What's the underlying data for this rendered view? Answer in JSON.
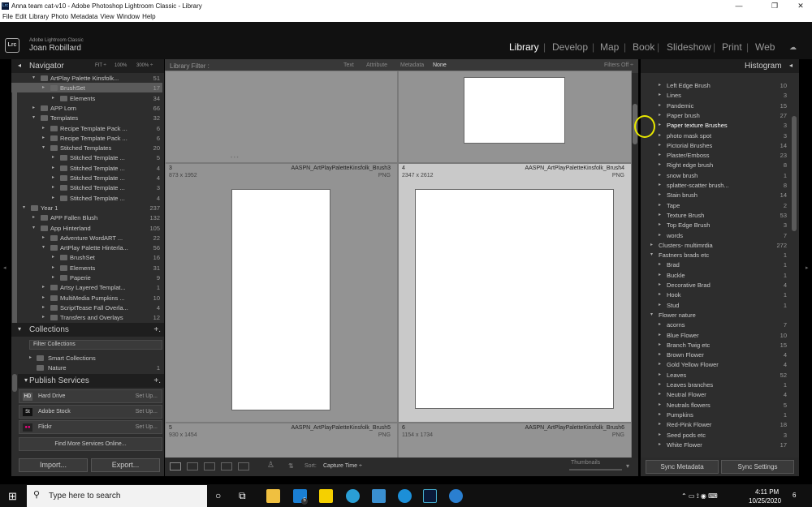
{
  "window": {
    "title": "Anna team cat-v10 - Adobe Photoshop Lightroom Classic - Library",
    "app_icon": "Lrc",
    "minimize": "—",
    "restore": "❐",
    "close": "✕"
  },
  "menu": [
    "File",
    "Edit",
    "Library",
    "Photo",
    "Metadata",
    "View",
    "Window",
    "Help"
  ],
  "identity": {
    "logo": "Lrc",
    "product": "Adobe Lightroom Classic",
    "user": "Joan Robillard"
  },
  "modules": [
    "Library",
    "Develop",
    "Map",
    "Book",
    "Slideshow",
    "Print",
    "Web"
  ],
  "active_module": "Library",
  "navigator": {
    "title": "Navigator",
    "fit": "FIT ÷",
    "z100": "100%",
    "z300": "300% ÷"
  },
  "folders": [
    {
      "label": "ArtPlay Palette Kinsfolk...",
      "count": "51"
    },
    {
      "label": "BrushSet",
      "count": "17"
    },
    {
      "label": "Elements",
      "count": "34"
    },
    {
      "label": "APP Lorn",
      "count": "66"
    },
    {
      "label": "Templates",
      "count": "32"
    },
    {
      "label": "Recipe Template Pack ...",
      "count": "6"
    },
    {
      "label": "Recipe Template Pack ...",
      "count": "6"
    },
    {
      "label": "Stitched Templates",
      "count": "20"
    },
    {
      "label": "Stitched Template ...",
      "count": "5"
    },
    {
      "label": "Stitched Template ...",
      "count": "4"
    },
    {
      "label": "Stitched Template ...",
      "count": "4"
    },
    {
      "label": "Stitched Template ...",
      "count": "3"
    },
    {
      "label": "Stitched Template ...",
      "count": "4"
    },
    {
      "label": "Year 1",
      "count": "237"
    },
    {
      "label": "APP Fallen Blush",
      "count": "132"
    },
    {
      "label": "App Hinterland",
      "count": "105"
    },
    {
      "label": "Adventure WordART ...",
      "count": "22"
    },
    {
      "label": "ArtPlay Palette Hinterla...",
      "count": "56"
    },
    {
      "label": "BrushSet",
      "count": "16"
    },
    {
      "label": "Elements",
      "count": "31"
    },
    {
      "label": "Paperie",
      "count": "9"
    },
    {
      "label": "Artsy Layered Templat...",
      "count": "1"
    },
    {
      "label": "MultiMedia Pumpkins ...",
      "count": "10"
    },
    {
      "label": "ScriptTease Fall Overla...",
      "count": "4"
    },
    {
      "label": "Transfers and Overlays",
      "count": "12"
    }
  ],
  "collections": {
    "title": "Collections",
    "plus": "+.",
    "filter": "Filter Collections",
    "items": [
      {
        "label": "Smart Collections",
        "count": ""
      },
      {
        "label": "Nature",
        "count": "1"
      }
    ]
  },
  "publish": {
    "title": "Publish Services",
    "plus": "+.",
    "services": [
      {
        "label": "Hard Drive",
        "icon": "HD",
        "action": "Set Up..."
      },
      {
        "label": "Adobe Stock",
        "icon": "St",
        "action": "Set Up..."
      },
      {
        "label": "Flickr",
        "icon": "●●",
        "action": "Set Up..."
      }
    ],
    "find_more": "Find More Services Online..."
  },
  "left_buttons": {
    "import": "Import...",
    "export": "Export..."
  },
  "filter_bar": {
    "label": "Library Filter :",
    "tabs": [
      "Text",
      "Attribute",
      "Metadata",
      "None"
    ],
    "filters_off": "Filters Off ÷"
  },
  "grid_cells": [
    {
      "index": "3",
      "dims": "873 x 1952",
      "name": "AASPN_ArtPlayPaletteKinsfolk_Brush3",
      "ext": "PNG"
    },
    {
      "index": "4",
      "dims": "2347 x 2612",
      "name": "AASPN_ArtPlayPaletteKinsfolk_Brush4",
      "ext": "PNG"
    },
    {
      "index": "5",
      "dims": "930 x 1454",
      "name": "AASPN_ArtPlayPaletteKinsfolk_Brush5",
      "ext": "PNG"
    },
    {
      "index": "6",
      "dims": "1154 x 1734",
      "name": "AASPN_ArtPlayPaletteKinsfolk_Brush6",
      "ext": "PNG"
    }
  ],
  "toolbar": {
    "sort_label": "Sort:",
    "sort_value": "Capture Time ÷",
    "thumbnails": "Thumbnails"
  },
  "histogram": {
    "title": "Histogram"
  },
  "keywords": [
    {
      "label": "Left Edge Brush",
      "count": "10",
      "level": 1
    },
    {
      "label": "Lines",
      "count": "3",
      "level": 1
    },
    {
      "label": "Pandemic",
      "count": "15",
      "level": 1
    },
    {
      "label": "Paper brush",
      "count": "27",
      "level": 1
    },
    {
      "label": "Paper texture Brushes",
      "count": "3",
      "level": 1
    },
    {
      "label": "photo mask spot",
      "count": "3",
      "level": 1
    },
    {
      "label": "Pictorial Brushes",
      "count": "14",
      "level": 1
    },
    {
      "label": "Plaster/Emboss",
      "count": "23",
      "level": 1
    },
    {
      "label": "Right edge brush",
      "count": "8",
      "level": 1
    },
    {
      "label": "snow brush",
      "count": "1",
      "level": 1
    },
    {
      "label": "splatter-scatter brush...",
      "count": "8",
      "level": 1
    },
    {
      "label": "Stain brush",
      "count": "14",
      "level": 1
    },
    {
      "label": "Tape",
      "count": "2",
      "level": 1
    },
    {
      "label": "Texture Brush",
      "count": "53",
      "level": 1
    },
    {
      "label": "Top Edge Brush",
      "count": "3",
      "level": 1
    },
    {
      "label": "words",
      "count": "7",
      "level": 1
    },
    {
      "label": "Clusters- multimrdia",
      "count": "272",
      "level": 0
    },
    {
      "label": "Fastners brads etc",
      "count": "1",
      "level": 0
    },
    {
      "label": "Brad",
      "count": "1",
      "level": 1
    },
    {
      "label": "Buckle",
      "count": "1",
      "level": 1
    },
    {
      "label": "Decorative Brad",
      "count": "4",
      "level": 1
    },
    {
      "label": "Hook",
      "count": "1",
      "level": 1
    },
    {
      "label": "Stud",
      "count": "1",
      "level": 1
    },
    {
      "label": "Flower nature",
      "count": "",
      "level": 0
    },
    {
      "label": "acorns",
      "count": "7",
      "level": 1
    },
    {
      "label": "Blue Flower",
      "count": "10",
      "level": 1
    },
    {
      "label": "Branch Twig etc",
      "count": "15",
      "level": 1
    },
    {
      "label": "Brown Flower",
      "count": "4",
      "level": 1
    },
    {
      "label": "Gold Yellow Flower",
      "count": "4",
      "level": 1
    },
    {
      "label": "Leaves",
      "count": "52",
      "level": 1
    },
    {
      "label": "Leaves branches",
      "count": "1",
      "level": 1
    },
    {
      "label": "Neutral Flower",
      "count": "4",
      "level": 1
    },
    {
      "label": "Neutrals flowers",
      "count": "5",
      "level": 1
    },
    {
      "label": "Pumpkins",
      "count": "1",
      "level": 1
    },
    {
      "label": "Red-Pink Flower",
      "count": "18",
      "level": 1
    },
    {
      "label": "Seed pods etc",
      "count": "3",
      "level": 1
    },
    {
      "label": "White Flower",
      "count": "17",
      "level": 1
    }
  ],
  "right_buttons": {
    "sync_metadata": "Sync Metadata",
    "sync_settings": "Sync Settings"
  },
  "taskbar": {
    "search": "Type here to search",
    "time": "4:11 PM",
    "date": "10/25/2020",
    "mail_badge": "5",
    "notif": "6"
  },
  "colors": {
    "highlight_circle": "#e8e800",
    "accent": "#0078d7"
  }
}
